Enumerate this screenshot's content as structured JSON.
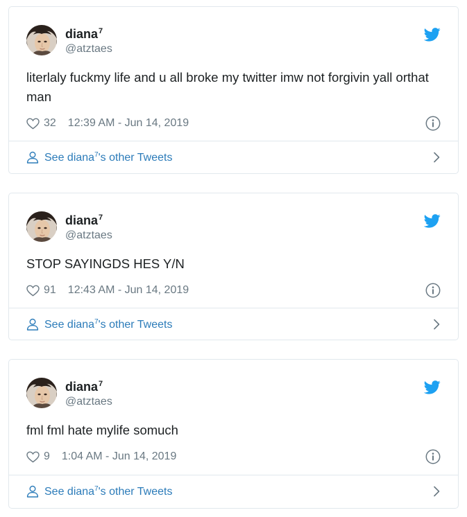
{
  "colors": {
    "link_blue": "#2b7bb9",
    "twitter_blue": "#1da1f2",
    "muted_text": "#697882",
    "border": "#e1e8ed"
  },
  "icons": [
    "twitter-bird-icon",
    "heart-icon",
    "info-icon",
    "person-icon",
    "chevron-right-icon"
  ],
  "tweets": [
    {
      "display_name": "diana",
      "name_superscript": "7",
      "handle": "@atztaes",
      "text": "literlaly fuckmy life and u all broke my twitter imw not forgivin yall orthat man",
      "likes": "32",
      "timestamp": "12:39 AM - Jun 14, 2019",
      "footer_prefix": "See diana",
      "footer_superscript": "7",
      "footer_suffix": "'s other Tweets"
    },
    {
      "display_name": "diana",
      "name_superscript": "7",
      "handle": "@atztaes",
      "text": "STOP SAYINGDS HES Y/N",
      "likes": "91",
      "timestamp": "12:43 AM - Jun 14, 2019",
      "footer_prefix": "See diana",
      "footer_superscript": "7",
      "footer_suffix": "'s other Tweets"
    },
    {
      "display_name": "diana",
      "name_superscript": "7",
      "handle": "@atztaes",
      "text": "fml fml hate mylife somuch",
      "likes": "9",
      "timestamp": "1:04 AM - Jun 14, 2019",
      "footer_prefix": "See diana",
      "footer_superscript": "7",
      "footer_suffix": "'s other Tweets"
    }
  ]
}
